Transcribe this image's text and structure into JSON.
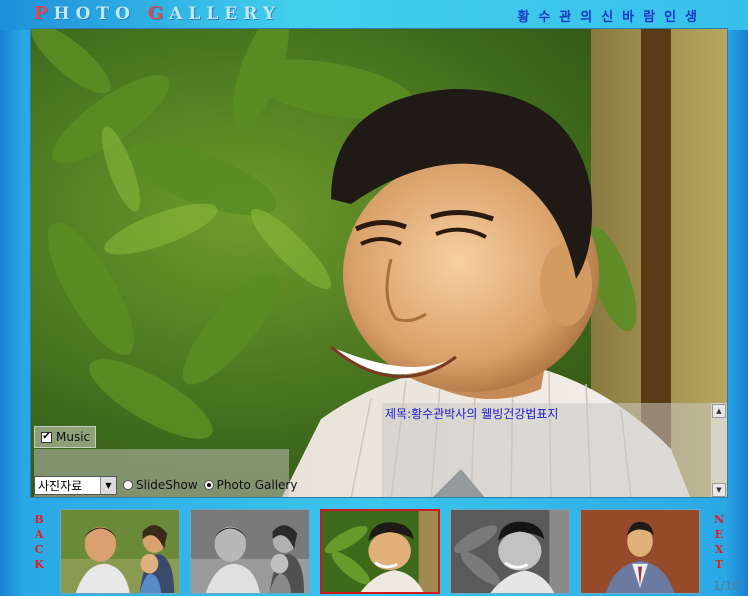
{
  "header": {
    "title_cap1": "P",
    "title_rest1": "HOTO",
    "title_cap2": "G",
    "title_rest2": "ALLERY",
    "subtitle": "황수관의신바람인생"
  },
  "controls": {
    "music_label": "Music",
    "music_checked": "✔",
    "category_selected": "사진자료",
    "slideshow_label": "SlideShow",
    "gallery_label": "Photo Gallery"
  },
  "caption": {
    "text": "제목:황수관박사의 웰빙건강법표지"
  },
  "nav": {
    "back_letters": [
      "B",
      "A",
      "C",
      "K"
    ],
    "next_letters": [
      "N",
      "E",
      "X",
      "T"
    ],
    "page_counter": "1/10"
  },
  "colors": {
    "accent_red": "#e02020",
    "caption_blue": "#1b1bd0",
    "subtitle_blue": "#1836c4"
  }
}
